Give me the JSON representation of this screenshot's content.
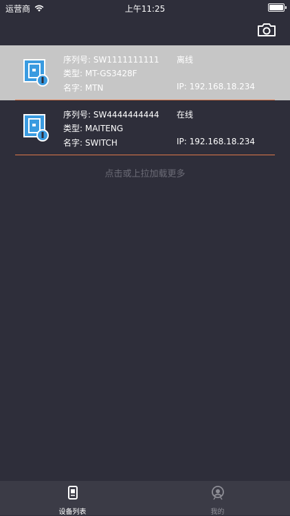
{
  "status_bar": {
    "carrier": "运营商",
    "time": "上午11:25"
  },
  "devices": [
    {
      "serial_label": "序列号: SW1111111111",
      "status": "离线",
      "type_label": "类型: MT-GS3428F",
      "name_label": "名字: MTN",
      "ip_label": "IP: 192.168.18.234",
      "selected": true
    },
    {
      "serial_label": "序列号: SW4444444444",
      "status": "在线",
      "type_label": "类型: MAITENG",
      "name_label": "名字: SWITCH",
      "ip_label": "IP: 192.168.18.234",
      "selected": false
    }
  ],
  "load_more": "点击或上拉加载更多",
  "tabs": [
    {
      "label": "设备列表",
      "icon": "device-list-icon",
      "active": true
    },
    {
      "label": "我的",
      "icon": "profile-icon",
      "active": false
    }
  ],
  "colors": {
    "background": "#2e2e3a",
    "selected_row": "#c6c6c6",
    "divider": "#e0794a",
    "tab_bar": "#3b3b46",
    "icon_blue": "#3a9be0"
  }
}
